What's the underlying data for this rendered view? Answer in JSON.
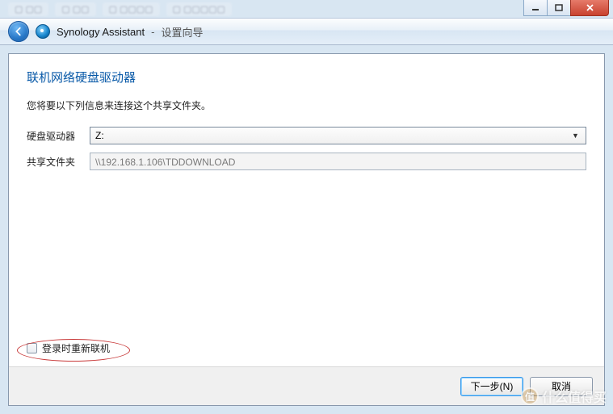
{
  "window": {
    "bg_tabs": [
      "…",
      "…",
      "…",
      "…"
    ]
  },
  "header": {
    "app_name": "Synology Assistant",
    "separator": " - ",
    "page_title": "设置向导"
  },
  "wizard": {
    "heading": "联机网络硬盘驱动器",
    "description": "您将要以下列信息来连接这个共享文件夹。",
    "drive_label": "硬盘驱动器",
    "drive_value": "Z:",
    "folder_label": "共享文件夹",
    "folder_value": "\\\\192.168.1.106\\TDDOWNLOAD",
    "reconnect_label": "登录时重新联机"
  },
  "footer": {
    "next": "下一步(N)",
    "cancel": "取消"
  },
  "watermark": {
    "text": "什么值得买",
    "badge": "值"
  }
}
